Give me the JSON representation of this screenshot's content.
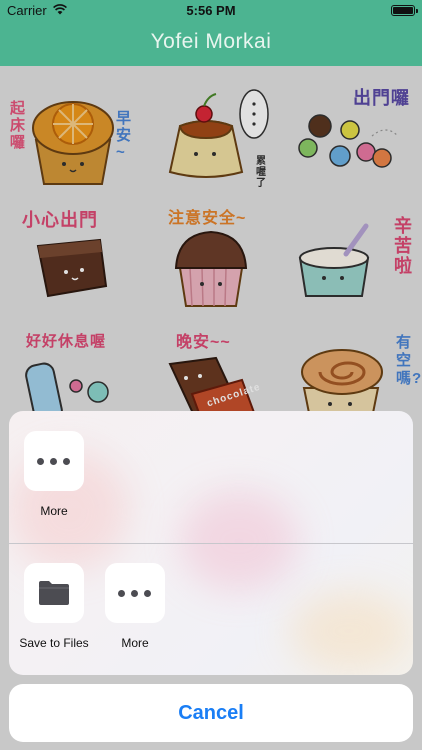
{
  "status_bar": {
    "carrier": "Carrier",
    "time": "5:56 PM",
    "wifi_icon": "wifi-icon",
    "battery_icon": "battery-icon",
    "battery_level": 1.0
  },
  "nav": {
    "title": "Yofei Morkai"
  },
  "stickers": [
    {
      "name": "orange-muffin",
      "caption": "起床囉 早安~"
    },
    {
      "name": "pudding-cherry",
      "caption": "累喔了"
    },
    {
      "name": "colorful-balls",
      "caption": "出門囉"
    },
    {
      "name": "chocolate-cake",
      "caption": "小心出門"
    },
    {
      "name": "strawberry-cupcake",
      "caption": "注意安全~"
    },
    {
      "name": "cream-cup",
      "caption": "辛苦啦"
    },
    {
      "name": "ice-pop",
      "caption": "好好休息喔"
    },
    {
      "name": "chocolate-bar",
      "caption": "晚安~~",
      "wrapper_text": "chocolate"
    },
    {
      "name": "cinnamon-roll",
      "caption": "有空嗎?"
    }
  ],
  "share_sheet": {
    "row1": [
      {
        "label": "More",
        "icon": "more-icon"
      }
    ],
    "row2": [
      {
        "label": "Save to Files",
        "icon": "folder-icon"
      },
      {
        "label": "More",
        "icon": "more-icon"
      }
    ]
  },
  "cancel_label": "Cancel",
  "colors": {
    "nav_green": "#4cb491",
    "cancel_blue": "#1a7ef5",
    "icon_gray": "#4c4c52"
  }
}
